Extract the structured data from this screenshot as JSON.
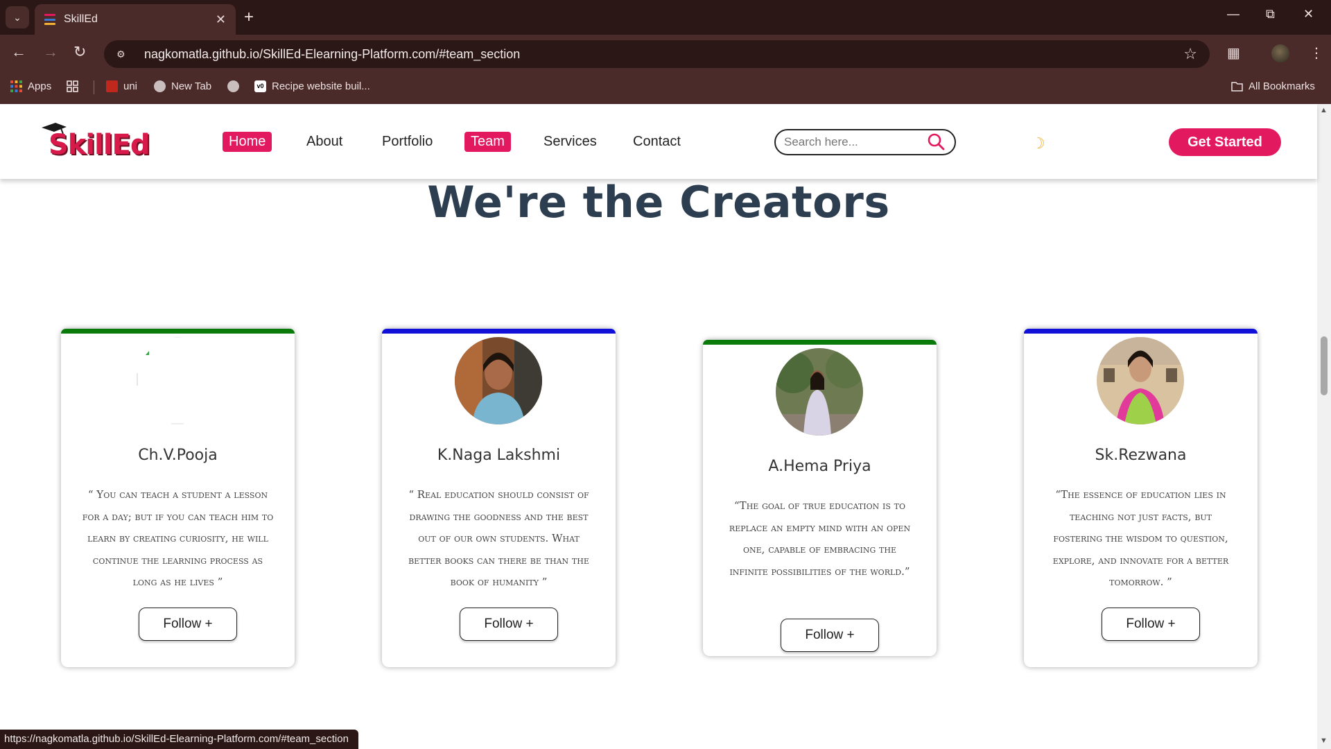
{
  "browser": {
    "tab_title": "SkillEd",
    "url": "nagkomatla.github.io/SkillEd-Elearning-Platform.com/#team_section",
    "status_url": "https://nagkomatla.github.io/SkillEd-Elearning-Platform.com/#team_section",
    "bookmarks": [
      {
        "label": "Apps",
        "icon": "apps-grid-icon"
      },
      {
        "label": "",
        "icon": "tab-groups-icon"
      },
      {
        "label": "uni",
        "icon": "uni-favicon"
      },
      {
        "label": "New Tab",
        "icon": "globe-icon"
      },
      {
        "label": "",
        "icon": "globe-icon"
      },
      {
        "label": "Recipe website buil...",
        "icon": "v0-favicon"
      }
    ],
    "all_bookmarks": "All Bookmarks"
  },
  "site": {
    "logo_text": "SkillEd",
    "nav": [
      {
        "label": "Home",
        "active": true
      },
      {
        "label": "About",
        "active": false
      },
      {
        "label": "Portfolio",
        "active": false
      },
      {
        "label": "Team",
        "active": true
      },
      {
        "label": "Services",
        "active": false
      },
      {
        "label": "Contact",
        "active": false
      }
    ],
    "search_placeholder": "Search here...",
    "cta": "Get Started",
    "accent": "#e3195f"
  },
  "section": {
    "title": "We're the Creators"
  },
  "team": [
    {
      "name": "Ch.V.Pooja",
      "quote": "“ You can teach a student a lesson for a day; but if you can teach him to learn by creating curiosity, he will continue the learning process as long as he lives ”",
      "follow": "Follow +",
      "accent": "#0a7a0a",
      "avatar_loaded": false
    },
    {
      "name": "K.Naga Lakshmi",
      "quote": "“ Real education should consist of drawing the goodness and the best out of our own students. What better books can there be than the book of humanity ”",
      "follow": "Follow +",
      "accent": "#1010d8",
      "avatar_loaded": true
    },
    {
      "name": "A.Hema Priya",
      "quote": "“The goal of true education is to replace an empty mind with an open one, capable of embracing the infinite possibilities of the world.”",
      "follow": "Follow +",
      "accent": "#0a7a0a",
      "avatar_loaded": true
    },
    {
      "name": "Sk.Rezwana",
      "quote": "“The essence of education lies in teaching not just facts, but fostering the wisdom to question, explore, and innovate for a better tomorrow. ”",
      "follow": "Follow +",
      "accent": "#1010d8",
      "avatar_loaded": true
    }
  ]
}
